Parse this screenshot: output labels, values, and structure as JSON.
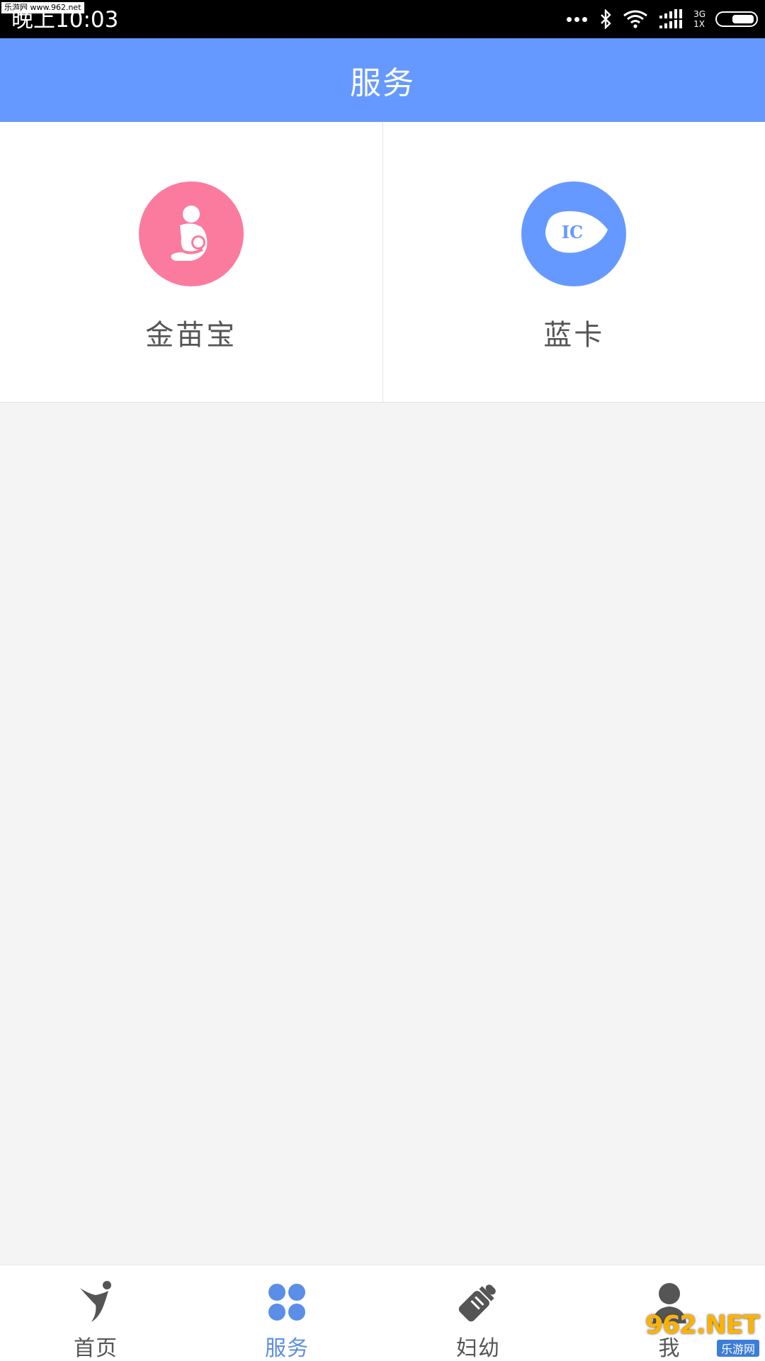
{
  "status_bar": {
    "watermark": "乐游网 www.962.net",
    "time": "晚上10:03",
    "network_top": "3G",
    "network_bottom": "1X",
    "icons": [
      "more-dots-icon",
      "bluetooth-icon",
      "wifi-icon",
      "signal-icon",
      "battery-icon"
    ]
  },
  "header": {
    "title": "服务"
  },
  "services": [
    {
      "label": "金苗宝",
      "icon": "breastfeeding-icon",
      "color": "#fb7b9f"
    },
    {
      "label": "蓝卡",
      "icon": "ic-card-icon",
      "icon_text": "IC",
      "color": "#6699ff"
    }
  ],
  "bottom_nav": {
    "items": [
      {
        "label": "首页",
        "icon": "home-figure-icon",
        "active": false
      },
      {
        "label": "服务",
        "icon": "clover-icon",
        "active": true
      },
      {
        "label": "妇幼",
        "icon": "baby-bottle-icon",
        "active": false
      },
      {
        "label": "我",
        "icon": "person-icon",
        "active": false
      }
    ],
    "active_color": "#5b8ee6"
  },
  "watermark_bottom": {
    "main": "962.NET",
    "sub": "乐游网"
  },
  "colors": {
    "header": "#6699ff",
    "background": "#f4f4f4"
  }
}
